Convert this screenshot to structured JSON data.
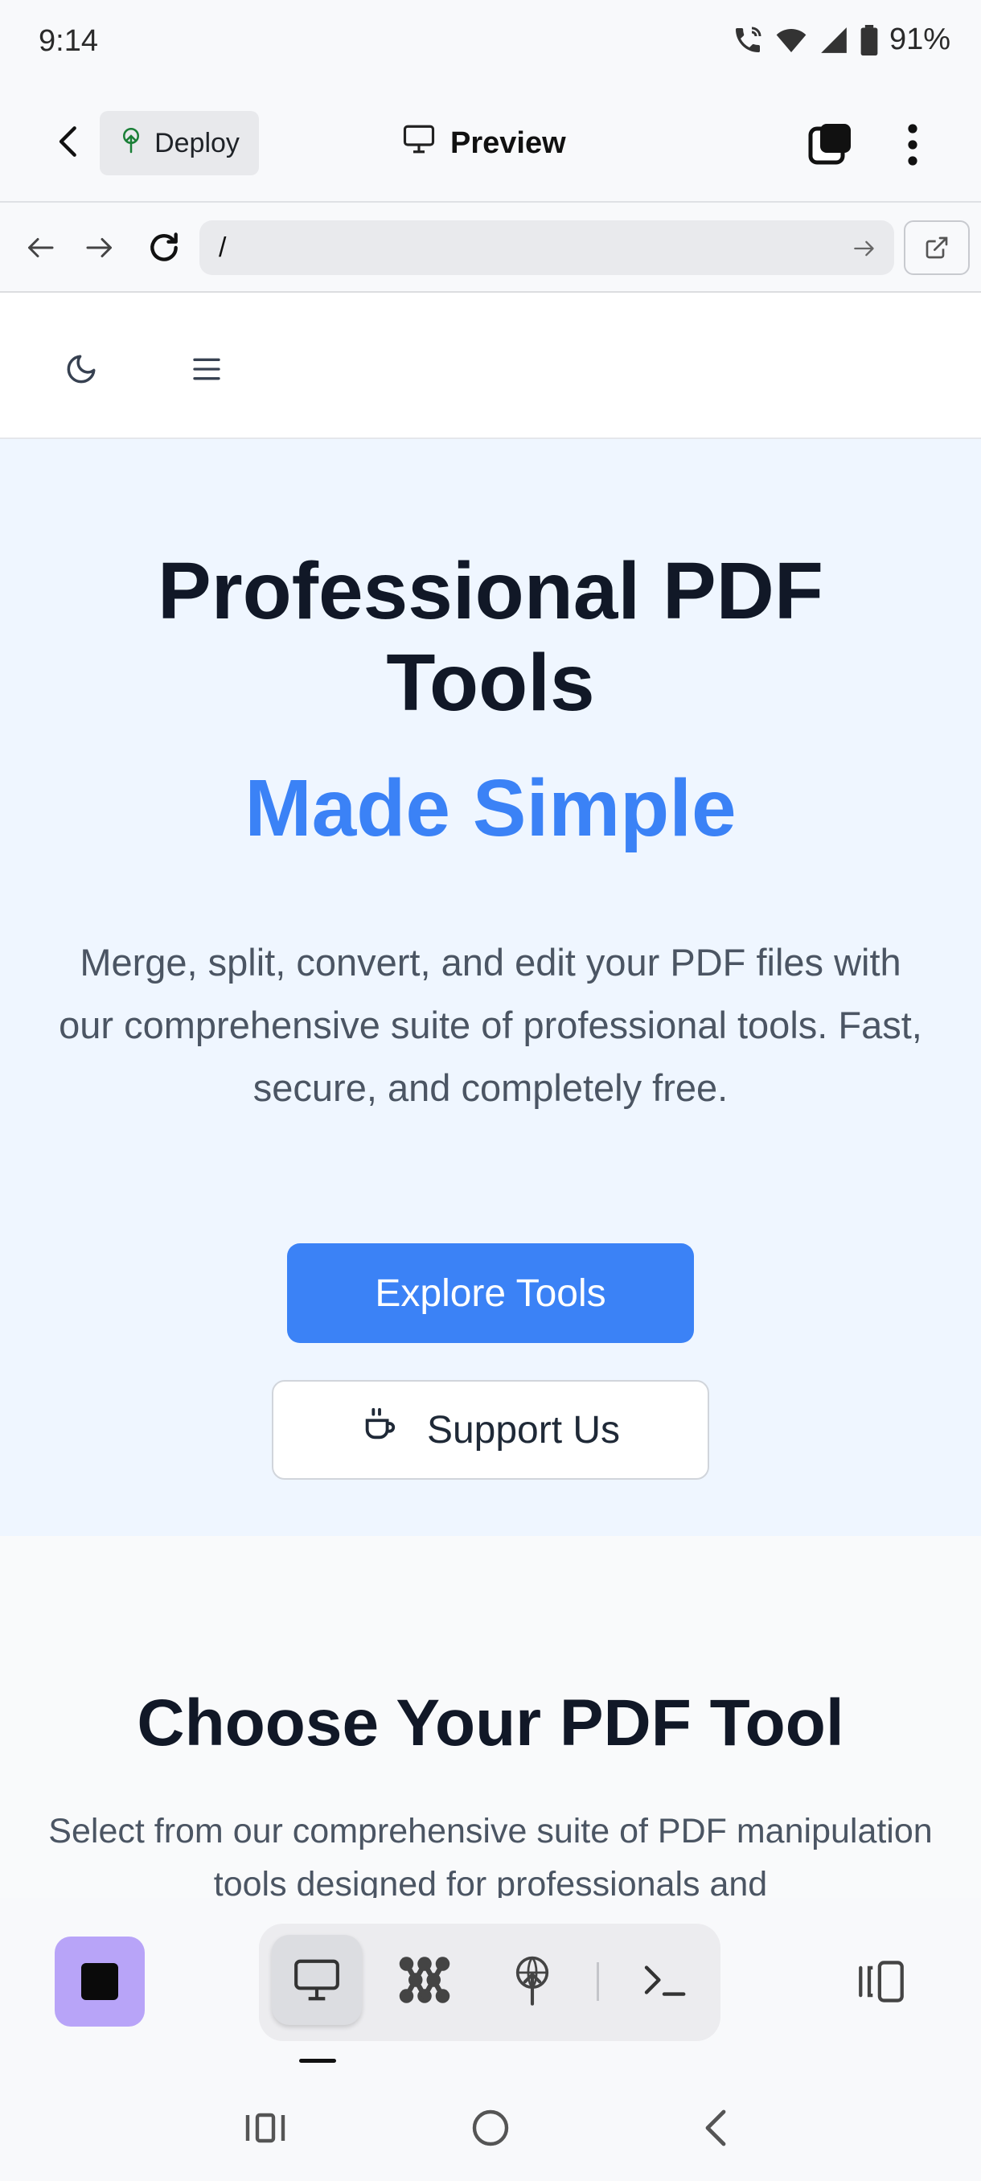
{
  "status_bar": {
    "time": "9:14",
    "battery": "91%",
    "icons": [
      "wifi-calling-icon",
      "wifi-6-icon",
      "signal-icon",
      "battery-icon"
    ]
  },
  "app_header": {
    "deploy_label": "Deploy",
    "title": "Preview"
  },
  "browser": {
    "url": "/"
  },
  "site": {
    "hero": {
      "title": "Professional PDF Tools",
      "subtitle": "Made Simple",
      "description": "Merge, split, convert, and edit your PDF files with our comprehensive suite of professional tools. Fast, secure, and completely free.",
      "primary_button": "Explore Tools",
      "secondary_button": "Support Us"
    },
    "tools_section": {
      "title": "Choose Your PDF Tool",
      "description": "Select from our comprehensive suite of PDF manipulation tools designed for professionals and"
    }
  },
  "colors": {
    "accent": "#3b82f6",
    "hero_bg": "#eff6ff",
    "stop_button": "#b8a4f8",
    "heading": "#111827"
  }
}
